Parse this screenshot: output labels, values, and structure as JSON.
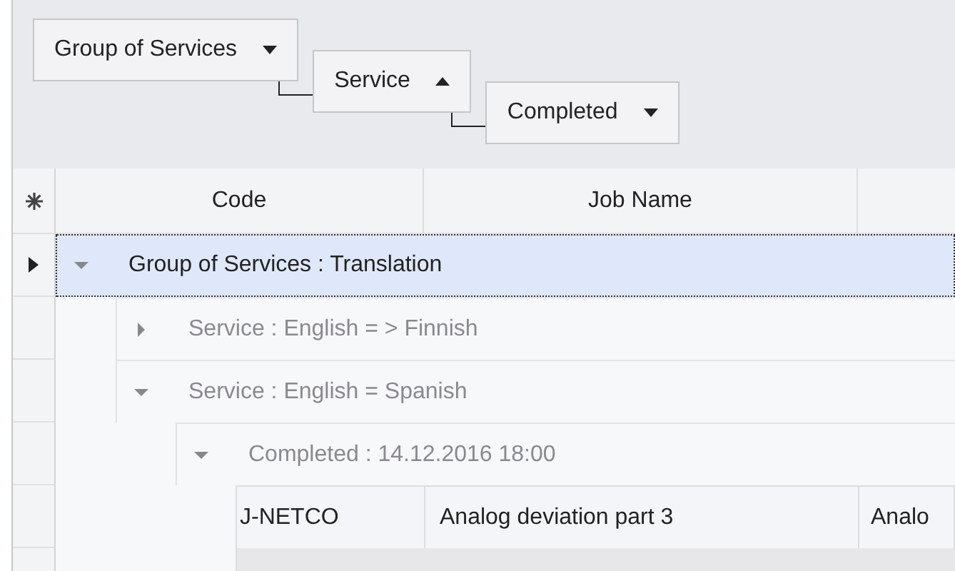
{
  "group_panel": {
    "chips": [
      {
        "label": "Group of Services",
        "ascending": false
      },
      {
        "label": "Service",
        "ascending": true
      },
      {
        "label": "Completed",
        "ascending": false
      }
    ]
  },
  "columns": [
    "Code",
    "Job Name"
  ],
  "groups": [
    {
      "label": "Group of Services : Translation",
      "expanded": true,
      "selected": true,
      "children": [
        {
          "label": "Service : English = > Finnish",
          "expanded": false,
          "selected": false
        },
        {
          "label": "Service : English = Spanish",
          "expanded": true,
          "selected": false,
          "children": [
            {
              "label": "Completed : 14.12.2016 18:00",
              "expanded": true,
              "selected": false,
              "rows": [
                {
                  "cells": [
                    "J-NETCO",
                    "Analog deviation part 3",
                    "Analo"
                  ]
                }
              ]
            }
          ]
        }
      ]
    }
  ]
}
